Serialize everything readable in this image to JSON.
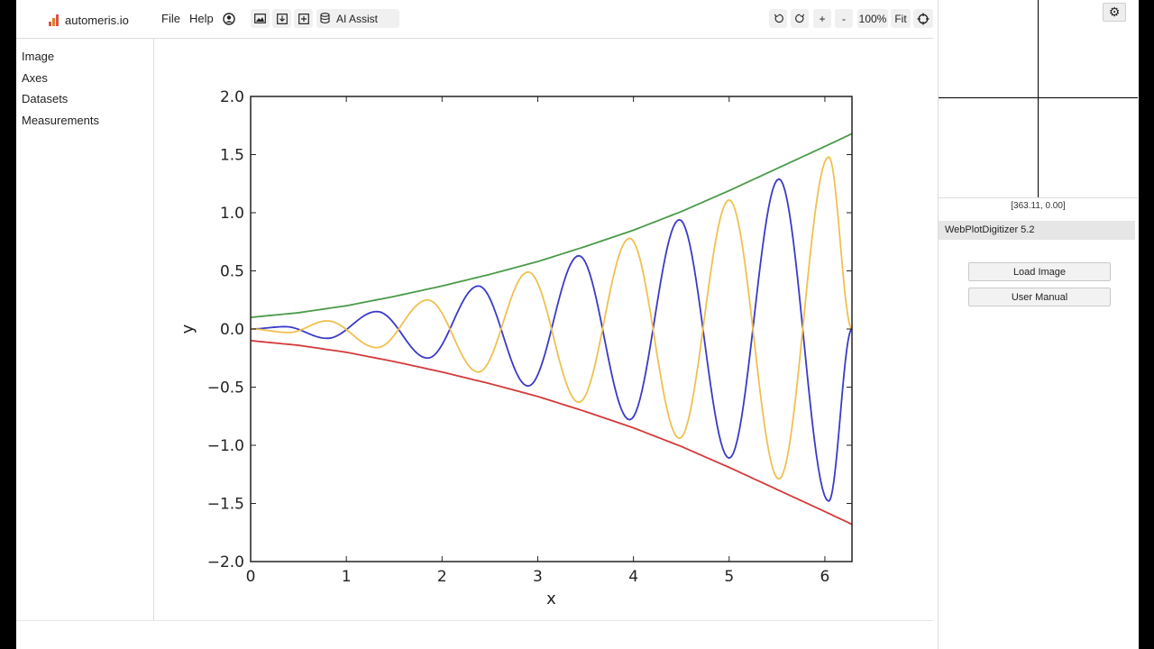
{
  "app": {
    "brand": "automeris.io",
    "menu": {
      "file": "File",
      "help": "Help"
    },
    "toolbar": {
      "ai_assist": "AI Assist",
      "zoom_in": "+",
      "zoom_out": "-",
      "zoom_level": "100%",
      "fit": "Fit"
    }
  },
  "sidebar": {
    "items": [
      {
        "label": "Image"
      },
      {
        "label": "Axes"
      },
      {
        "label": "Datasets"
      },
      {
        "label": "Measurements"
      }
    ]
  },
  "right_panel": {
    "cursor_readout": "[363.11, 0.00]",
    "version": "WebPlotDigitizer 5.2",
    "load_image": "Load Image",
    "user_manual": "User Manual"
  },
  "chart_data": {
    "type": "line",
    "title": "",
    "xlabel": "x",
    "ylabel": "y",
    "xlim": [
      0,
      6.2832
    ],
    "ylim": [
      -2.0,
      2.0
    ],
    "xticks": [
      0,
      1,
      2,
      3,
      4,
      5,
      6
    ],
    "yticks": [
      -2.0,
      -1.5,
      -1.0,
      -0.5,
      0.0,
      0.5,
      1.0,
      1.5,
      2.0
    ],
    "ytick_labels": [
      "−2.0",
      "−1.5",
      "−1.0",
      "−0.5",
      "0.0",
      "0.5",
      "1.0",
      "1.5",
      "2.0"
    ],
    "xtick_labels": [
      "0",
      "1",
      "2",
      "3",
      "4",
      "5",
      "6"
    ],
    "grid": false,
    "series": [
      {
        "color": "#4a9a4a",
        "x": [
          0,
          0.5,
          1,
          1.5,
          2,
          2.5,
          3,
          3.5,
          4,
          4.5,
          5,
          5.5,
          6,
          6.2832
        ],
        "y": [
          0.1,
          0.14,
          0.2,
          0.28,
          0.37,
          0.47,
          0.58,
          0.71,
          0.85,
          1.01,
          1.19,
          1.38,
          1.57,
          1.68
        ]
      },
      {
        "color": "#d43a3a",
        "x": [
          0,
          0.5,
          1,
          1.5,
          2,
          2.5,
          3,
          3.5,
          4,
          4.5,
          5,
          5.5,
          6,
          6.2832
        ],
        "y": [
          -0.1,
          -0.14,
          -0.2,
          -0.28,
          -0.37,
          -0.47,
          -0.58,
          -0.71,
          -0.85,
          -1.01,
          -1.19,
          -1.38,
          -1.57,
          -1.68
        ]
      },
      {
        "color": "#3a3ac8",
        "x": [
          0,
          0.36,
          0.8,
          1.32,
          1.85,
          2.38,
          2.9,
          3.43,
          3.96,
          4.48,
          5.0,
          5.52,
          6.04,
          6.2832
        ],
        "y": [
          0.0,
          0.02,
          -0.08,
          0.15,
          -0.25,
          0.37,
          -0.49,
          0.63,
          -0.78,
          0.94,
          -1.11,
          1.29,
          -1.48,
          0.0
        ]
      },
      {
        "color": "#f0c050",
        "x": [
          0,
          0.4,
          0.8,
          1.32,
          1.85,
          2.38,
          2.9,
          3.43,
          3.96,
          4.48,
          5.0,
          5.52,
          6.04,
          6.2832
        ],
        "y": [
          0.0,
          -0.03,
          0.07,
          -0.16,
          0.25,
          -0.37,
          0.49,
          -0.63,
          0.78,
          -0.94,
          1.11,
          -1.29,
          1.48,
          0.0
        ]
      }
    ]
  }
}
